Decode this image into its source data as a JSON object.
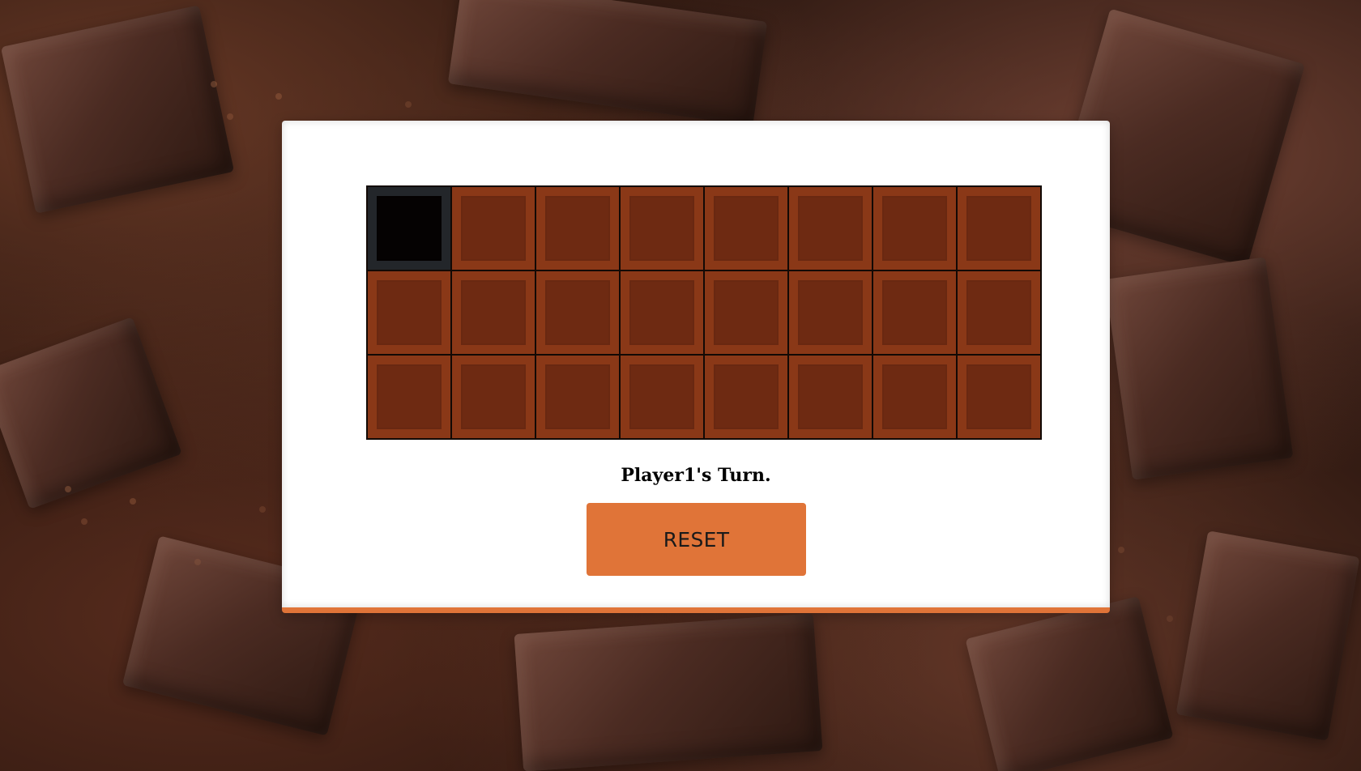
{
  "game": {
    "status_text": "Player1's Turn.",
    "reset_label": "RESET",
    "accent_color": "#e07438",
    "tile_color": "#8a3817",
    "tile_inner_color": "#6e2a12",
    "poison_tile_color": "#050202"
  },
  "board": {
    "rows": 3,
    "cols": 8,
    "poison_cell": [
      0,
      0
    ]
  }
}
